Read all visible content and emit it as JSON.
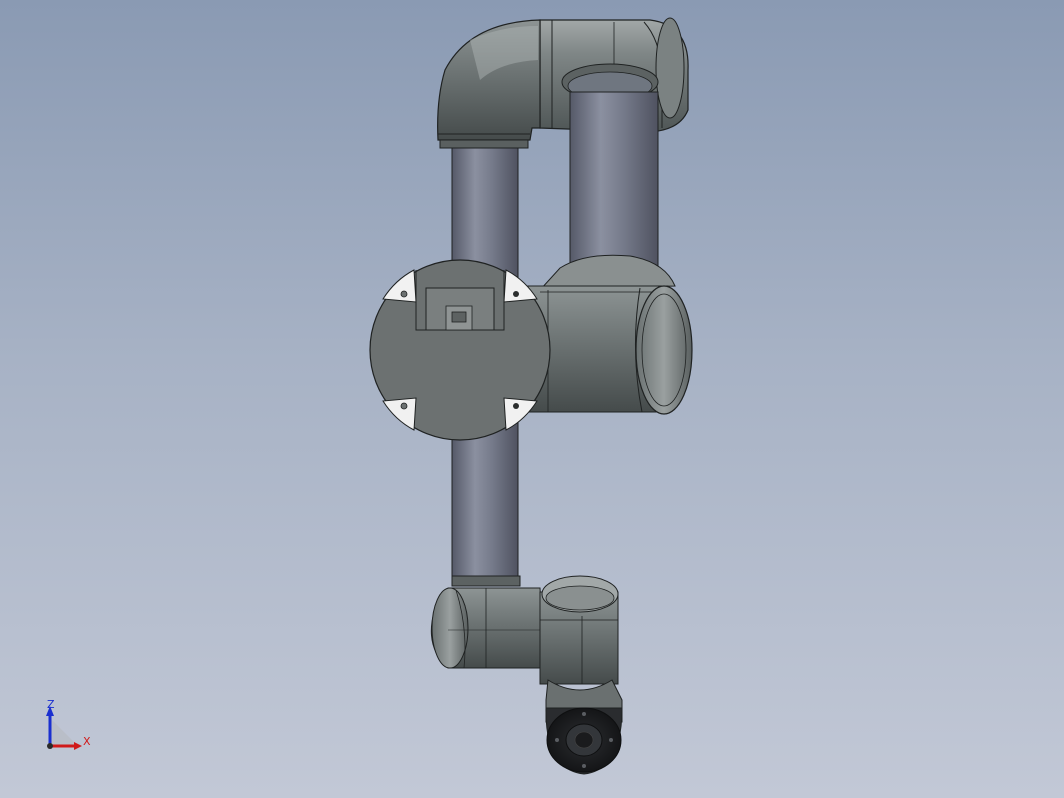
{
  "scene": {
    "description_visible_text": "",
    "colors": {
      "background_top": "#8a9ab3",
      "background_bottom": "#c2c8d6",
      "body_shade": "#5e6566",
      "body_mid": "#7d8585",
      "body_light": "#a4aaaa",
      "tube_dark": "#5d6170",
      "tube_light": "#8d92a2",
      "plate": "#6b7070",
      "edge": "#1f2222",
      "flange_dark": "#1e1f22"
    },
    "parts": [
      "shoulder-elbow-housing",
      "upper-arm-tube",
      "forearm-tube",
      "elbow-joint",
      "base-mounting-plate",
      "wrist-joint-1",
      "wrist-joint-2",
      "tool-flange"
    ]
  },
  "triad": {
    "z_label": "Z",
    "x_label": "X",
    "z_color": "#1a2fd0",
    "x_color": "#d01a1a"
  }
}
